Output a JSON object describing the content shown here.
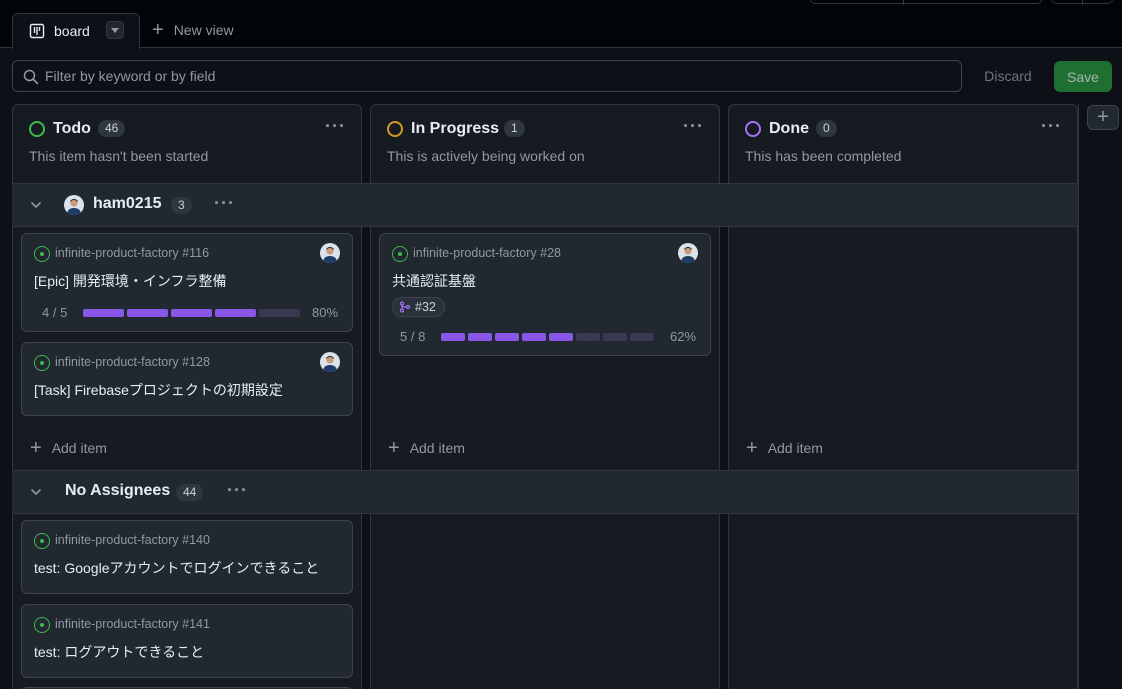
{
  "view_tabs": {
    "board_label": "board",
    "new_view_label": "New view"
  },
  "toolbar": {
    "filter_placeholder": "Filter by keyword or by field",
    "discard_label": "Discard",
    "save_label": "Save",
    "add_column_label": "+"
  },
  "columns": [
    {
      "name": "Todo",
      "count": "46",
      "description": "This item hasn't been started",
      "status_color": "#3fb950"
    },
    {
      "name": "In Progress",
      "count": "1",
      "description": "This is actively being worked on",
      "status_color": "#d29922"
    },
    {
      "name": "Done",
      "count": "0",
      "description": "This has been completed",
      "status_color": "#a371f7"
    }
  ],
  "groups": [
    {
      "name": "ham0215",
      "count": "3",
      "todo_cards": [
        {
          "repo": "infinite-product-factory #116",
          "title": "[Epic] 開発環境・インフラ整備",
          "progress_label": "4 / 5",
          "progress_fraction": 0.8,
          "percent": "80%"
        },
        {
          "repo": "infinite-product-factory #128",
          "title": "[Task] Firebaseプロジェクトの初期設定"
        }
      ],
      "in_progress_cards": [
        {
          "repo": "infinite-product-factory #28",
          "title": "共通認証基盤",
          "pr_ref": "#32",
          "progress_label": "5 / 8",
          "progress_fraction": 0.625,
          "percent": "62%"
        }
      ]
    },
    {
      "name": "No Assignees",
      "count": "44",
      "todo_cards": [
        {
          "repo": "infinite-product-factory #140",
          "title": "test: Googleアカウントでログインできること"
        },
        {
          "repo": "infinite-product-factory #141",
          "title": "test: ログアウトできること"
        }
      ]
    }
  ],
  "add_item_label": "Add item",
  "icons": {
    "view_tab": "board-icon",
    "search": "search-icon",
    "issue": "issue-open-icon",
    "pr": "pull-request-icon",
    "group_toggle": "chevron-down-icon",
    "more": "kebab-horizontal-icon"
  },
  "colors": {
    "accent_progress": "#8957e5",
    "save_button": "#1f6f33",
    "issue_open": "#3fb950"
  }
}
